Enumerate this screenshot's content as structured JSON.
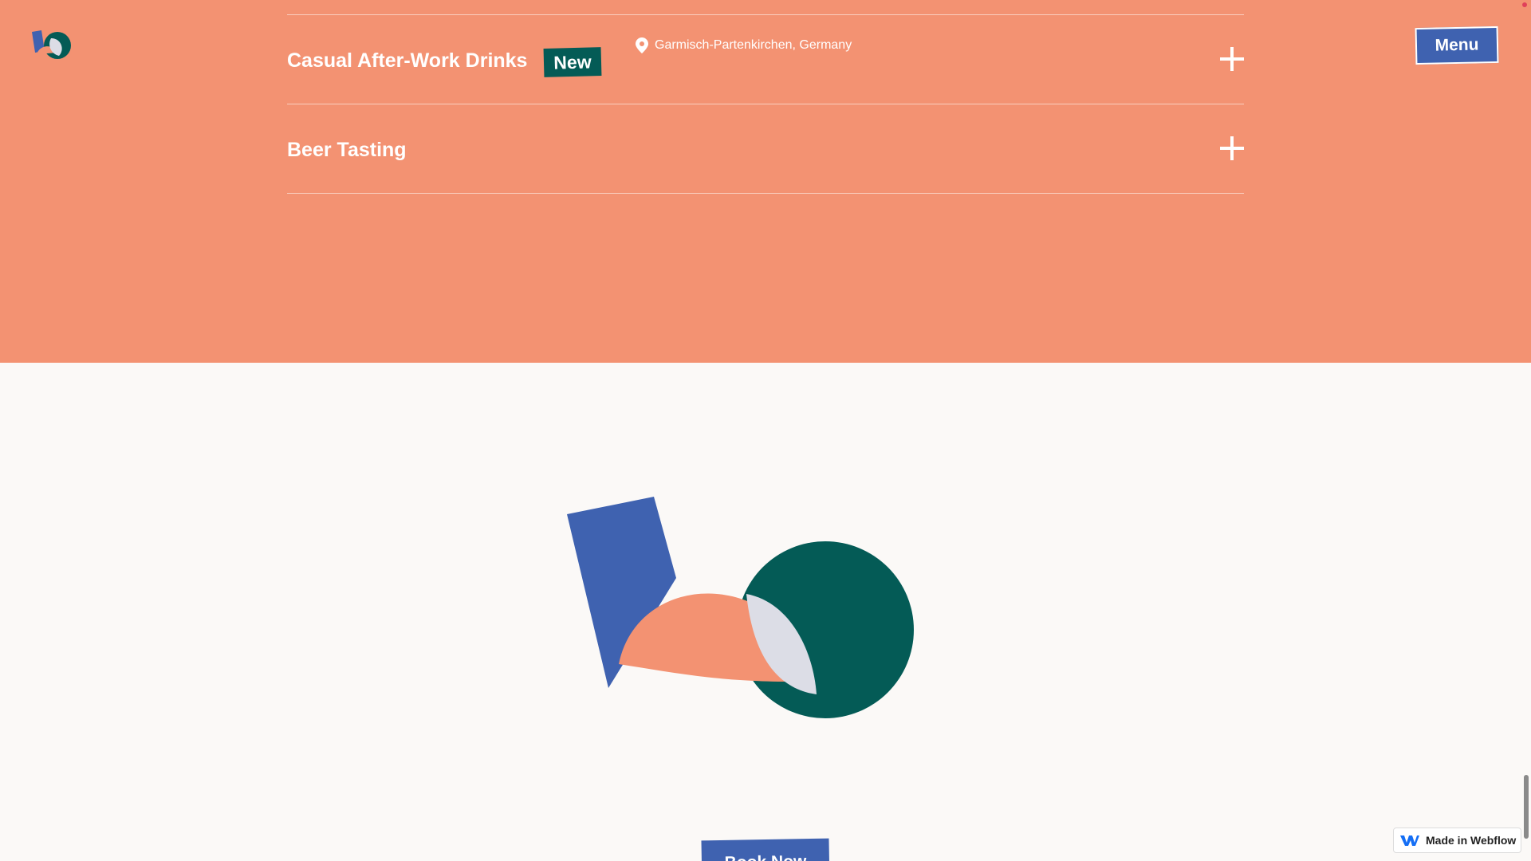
{
  "nav": {
    "menu_label": "Menu"
  },
  "events": [
    {
      "title": "Casual After-Work Drinks",
      "badge": "New",
      "location": "Garmisch-Partenkirchen, Germany"
    },
    {
      "title": "Beer Tasting"
    }
  ],
  "cta": {
    "book_label": "Book Now"
  },
  "webflow_badge": {
    "label": "Made in Webflow"
  },
  "colors": {
    "coral": "#f39272",
    "blue": "#3f62b0",
    "teal": "#045b56",
    "light_gray": "#dcdde6",
    "background": "#fbf9f7"
  },
  "icons": [
    "logo-icon",
    "location-pin-icon",
    "plus-icon",
    "webflow-icon"
  ]
}
